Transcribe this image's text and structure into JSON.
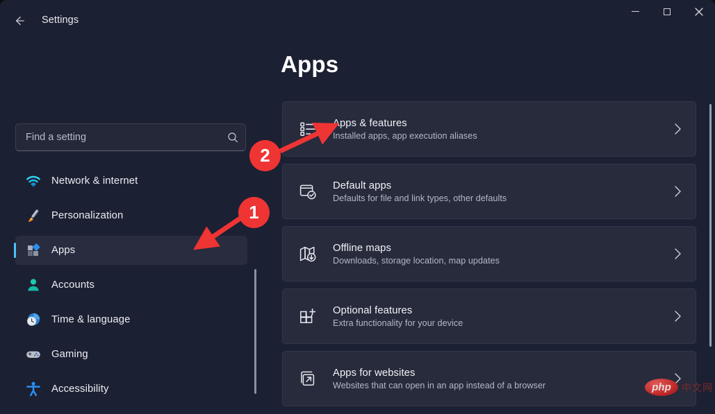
{
  "window": {
    "title": "Settings",
    "back_label": "Back",
    "controls": {
      "minimize": "Minimize",
      "maximize": "Maximize",
      "close": "Close"
    }
  },
  "search": {
    "placeholder": "Find a setting",
    "value": "",
    "icon": "search-icon"
  },
  "sidebar": {
    "items": [
      {
        "label": "Network & internet",
        "icon": "wifi-icon",
        "selected": false
      },
      {
        "label": "Personalization",
        "icon": "paintbrush-icon",
        "selected": false
      },
      {
        "label": "Apps",
        "icon": "apps-icon",
        "selected": true
      },
      {
        "label": "Accounts",
        "icon": "person-icon",
        "selected": false
      },
      {
        "label": "Time & language",
        "icon": "clock-globe-icon",
        "selected": false
      },
      {
        "label": "Gaming",
        "icon": "gamepad-icon",
        "selected": false
      },
      {
        "label": "Accessibility",
        "icon": "accessibility-person-icon",
        "selected": false
      }
    ]
  },
  "main": {
    "title": "Apps",
    "cards": [
      {
        "title": "Apps & features",
        "subtitle": "Installed apps, app execution aliases",
        "icon": "list-icon"
      },
      {
        "title": "Default apps",
        "subtitle": "Defaults for file and link types, other defaults",
        "icon": "window-check-icon"
      },
      {
        "title": "Offline maps",
        "subtitle": "Downloads, storage location, map updates",
        "icon": "map-download-icon"
      },
      {
        "title": "Optional features",
        "subtitle": "Extra functionality for your device",
        "icon": "grid-plus-icon"
      },
      {
        "title": "Apps for websites",
        "subtitle": "Websites that can open in an app instead of a browser",
        "icon": "external-link-icon"
      }
    ]
  },
  "annotations": {
    "color": "#ef3434",
    "markers": [
      {
        "number": "1",
        "points_to": "sidebar-item-apps"
      },
      {
        "number": "2",
        "points_to": "card-apps-and-features"
      }
    ]
  },
  "watermark": {
    "php": "php",
    "cn": "中文网"
  },
  "colors": {
    "accent": "#4cc2ff",
    "background": "#1c2033",
    "card": "#272b3c",
    "annotation": "#ef3434"
  }
}
